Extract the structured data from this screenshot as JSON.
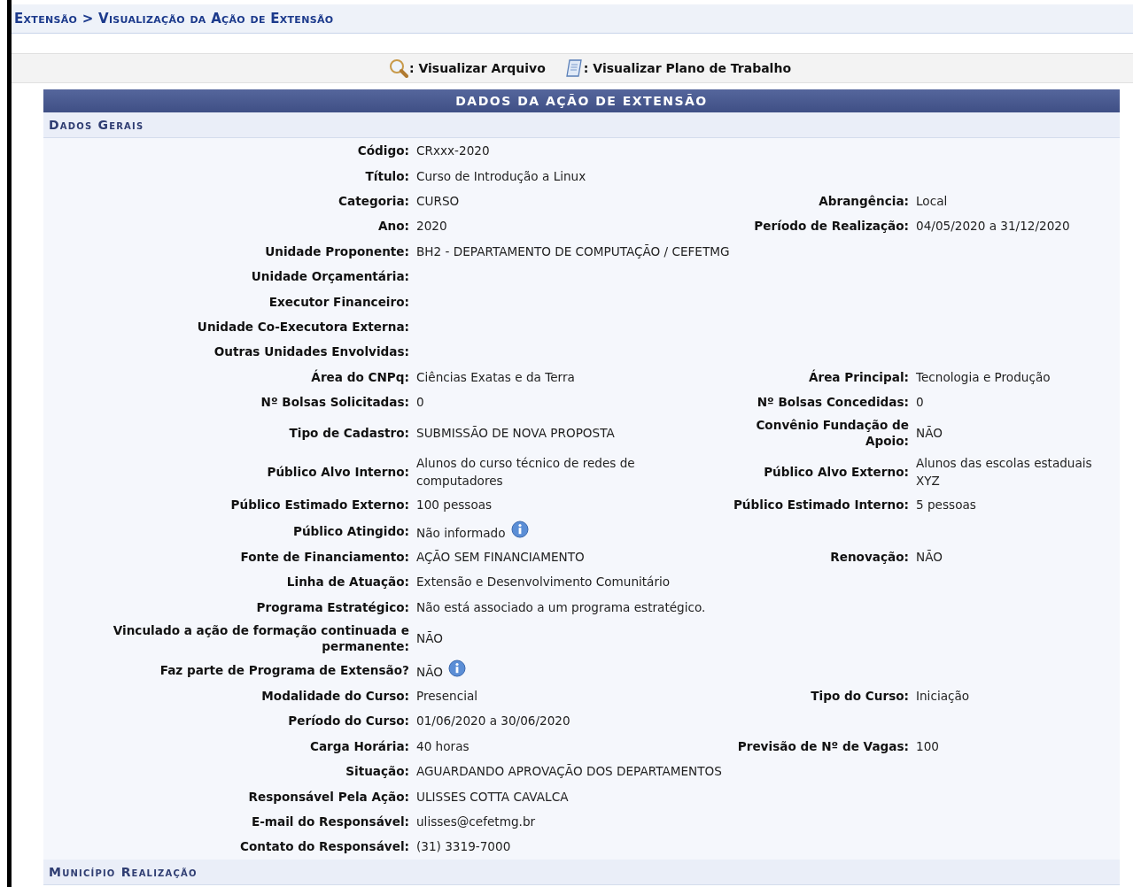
{
  "breadcrumb": "Extensão > Visualização da Ação de Extensão",
  "toolbar": [
    {
      "label": ": Visualizar Arquivo"
    },
    {
      "label": ": Visualizar Plano de Trabalho"
    }
  ],
  "panel": {
    "title": "DADOS DA AÇÃO DE EXTENSÃO",
    "sections": [
      {
        "title": "Dados Gerais",
        "rows": [
          {
            "fields": [
              {
                "label": "Código:",
                "value": "CRxxx-2020",
                "info": false
              }
            ]
          },
          {
            "fields": [
              {
                "label": "Título:",
                "value": "Curso de Introdução a Linux",
                "info": false
              }
            ]
          },
          {
            "fields": [
              {
                "label": "Categoria:",
                "value": "CURSO",
                "info": false
              },
              {
                "label": "Abrangência:",
                "value": "Local",
                "info": false
              }
            ]
          },
          {
            "fields": [
              {
                "label": "Ano:",
                "value": "2020",
                "info": false
              },
              {
                "label": "Período de Realização:",
                "value": "04/05/2020 a 31/12/2020",
                "info": false
              }
            ]
          },
          {
            "fields": [
              {
                "label": "Unidade Proponente:",
                "value": "BH2 - DEPARTAMENTO DE COMPUTAÇÃO / CEFETMG",
                "info": false
              }
            ]
          },
          {
            "fields": [
              {
                "label": "Unidade Orçamentária:",
                "info": false
              }
            ]
          },
          {
            "fields": [
              {
                "label": "Executor Financeiro:",
                "info": false
              }
            ]
          },
          {
            "fields": [
              {
                "label": "Unidade Co-Executora Externa:",
                "info": false
              }
            ]
          },
          {
            "fields": [
              {
                "label": "Outras Unidades Envolvidas:",
                "info": false
              }
            ]
          },
          {
            "fields": [
              {
                "label": "Área do CNPq:",
                "value": "Ciências Exatas e da Terra",
                "info": false
              },
              {
                "label": "Área Principal:",
                "value": "Tecnologia e Produção",
                "info": false
              }
            ]
          },
          {
            "fields": [
              {
                "label": "Nº Bolsas Solicitadas:",
                "value": "0",
                "info": false
              },
              {
                "label": "Nº Bolsas Concedidas:",
                "value": "0",
                "info": false
              }
            ]
          },
          {
            "fields": [
              {
                "label": "Tipo de Cadastro:",
                "value": "SUBMISSÃO DE NOVA PROPOSTA",
                "info": false
              },
              {
                "label": "Convênio Fundação de Apoio:",
                "value": "NÃO",
                "info": false
              }
            ]
          },
          {
            "fields": [
              {
                "label": "Público Alvo Interno:",
                "value": "Alunos do curso técnico de redes de computadores",
                "info": false
              },
              {
                "label": "Público Alvo Externo:",
                "value": "Alunos das escolas estaduais XYZ",
                "info": false
              }
            ]
          },
          {
            "fields": [
              {
                "label": "Público Estimado Externo:",
                "value": "100 pessoas",
                "info": false
              },
              {
                "label": "Público Estimado Interno:",
                "value": "5 pessoas",
                "info": false
              }
            ]
          },
          {
            "fields": [
              {
                "label": "Público Atingido:",
                "value": "Não informado",
                "info": true
              }
            ]
          },
          {
            "fields": [
              {
                "label": "Fonte de Financiamento:",
                "value": "AÇÃO SEM FINANCIAMENTO",
                "info": false
              },
              {
                "label": "Renovação:",
                "value": "NÃO",
                "info": false
              }
            ]
          },
          {
            "fields": [
              {
                "label": "Linha de Atuação:",
                "value": "Extensão e Desenvolvimento Comunitário",
                "info": false
              }
            ]
          },
          {
            "fields": [
              {
                "label": "Programa Estratégico:",
                "value": "Não está associado a um programa estratégico.",
                "info": false
              }
            ]
          },
          {
            "fields": [
              {
                "label": "Vinculado a ação de formação continuada e permanente:",
                "value": "NÃO",
                "info": false
              }
            ]
          },
          {
            "fields": [
              {
                "label": "Faz parte de Programa de Extensão?",
                "value": "NÃO",
                "info": true
              }
            ]
          },
          {
            "fields": [
              {
                "label": "Modalidade do Curso:",
                "value": "Presencial",
                "info": false
              },
              {
                "label": "Tipo do Curso:",
                "value": "Iniciação",
                "info": false
              }
            ]
          },
          {
            "fields": [
              {
                "label": "Período do Curso:",
                "value": "01/06/2020 a 30/06/2020",
                "info": false
              }
            ]
          },
          {
            "fields": [
              {
                "label": "Carga Horária:",
                "value": "40 horas",
                "info": false
              },
              {
                "label": "Previsão de Nº de Vagas:",
                "value": "100",
                "info": false
              }
            ]
          },
          {
            "fields": [
              {
                "label": "Situação:",
                "value": "AGUARDANDO APROVAÇÃO DOS DEPARTAMENTOS",
                "info": false
              }
            ]
          },
          {
            "fields": [
              {
                "label": "Responsável Pela Ação:",
                "value": "ULISSES COTTA CAVALCA",
                "info": false
              }
            ]
          },
          {
            "fields": [
              {
                "label": "E-mail do Responsável:",
                "value": "ulisses@cefetmg.br",
                "info": false
              }
            ]
          },
          {
            "fields": [
              {
                "label": "Contato do Responsável:",
                "value": "(31) 3319-7000",
                "info": false
              }
            ]
          }
        ]
      },
      {
        "title": "Município Realização"
      }
    ]
  }
}
